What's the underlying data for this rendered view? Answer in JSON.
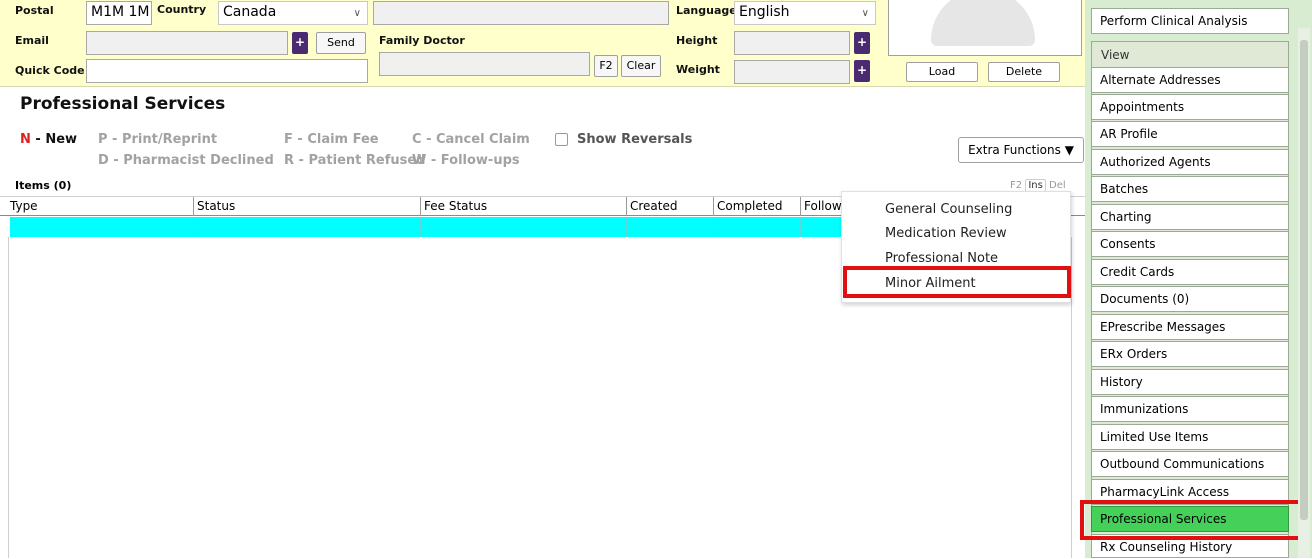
{
  "form": {
    "postal_label": "Postal",
    "postal_value": "M1M 1M",
    "country_label": "Country",
    "country_value": "Canada",
    "language_label": "Language",
    "language_value": "English",
    "email_label": "Email",
    "email_value": "",
    "send_label": "Send",
    "family_doctor_label": "Family Doctor",
    "family_doctor_value": "",
    "f2_label": "F2",
    "clear_label": "Clear",
    "height_label": "Height",
    "height_value": "",
    "weight_label": "Weight",
    "weight_value": "",
    "quick_code_label": "Quick Code",
    "quick_code_value": "",
    "plus_glyph": "+"
  },
  "photo": {
    "load_label": "Load",
    "delete_label": "Delete"
  },
  "professional_services": {
    "title": "Professional Services",
    "shortcuts": {
      "new_key": "N",
      "new_label": " - New",
      "print": "P - Print/Reprint",
      "claim_fee": "F - Claim Fee",
      "cancel_claim": "C  - Cancel Claim",
      "show_reversals": "Show Reversals",
      "pharmacist_declined": "D - Pharmacist Declined",
      "patient_refused": "R - Patient Refused",
      "follow_ups": "W - Follow-ups"
    },
    "extra_functions_label": "Extra Functions",
    "extra_functions_arrow": "▼"
  },
  "items": {
    "label": "Items (0)",
    "keys": [
      "F2",
      "Ins",
      "Del"
    ],
    "columns": [
      "Type",
      "Status",
      "Fee Status",
      "Created",
      "Completed",
      "Follow"
    ]
  },
  "popup_menu": {
    "items": [
      "General Counseling",
      "Medication Review",
      "Professional Note",
      "Minor Ailment"
    ],
    "highlighted": "Minor Ailment"
  },
  "right_panel": {
    "top_button": "Perform Clinical Analysis",
    "view_label": "View",
    "items": [
      "Alternate Addresses",
      "Appointments",
      "AR Profile",
      "Authorized Agents",
      "Batches",
      "Charting",
      "Consents",
      "Credit Cards",
      "Documents (0)",
      "EPrescribe Messages",
      "ERx Orders",
      "History",
      "Immunizations",
      "Limited Use Items",
      "Outbound Communications",
      "PharmacyLink Access",
      "Professional Services",
      "Rx Counseling History"
    ],
    "active_item": "Professional Services"
  },
  "colors": {
    "form_background": "#ffffcc",
    "selected_row": "#00ffff",
    "active_nav": "#45d05a",
    "highlight_box": "#e01010",
    "plus_button": "#4a2a70",
    "new_key": "#e0201c"
  }
}
